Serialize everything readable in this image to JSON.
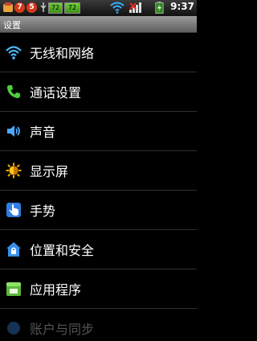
{
  "status_bar": {
    "notif_badge_1": "7",
    "notif_badge_2": "5",
    "battery_level_1": "72",
    "battery_level_2": "72",
    "time": "9:37"
  },
  "title": "设置",
  "menu": [
    {
      "label": "无线和网络",
      "icon": "wifi-icon"
    },
    {
      "label": "通话设置",
      "icon": "phone-icon"
    },
    {
      "label": "声音",
      "icon": "speaker-icon"
    },
    {
      "label": "显示屏",
      "icon": "brightness-icon"
    },
    {
      "label": "手势",
      "icon": "gesture-icon"
    },
    {
      "label": "位置和安全",
      "icon": "lock-icon"
    },
    {
      "label": "应用程序",
      "icon": "app-icon"
    },
    {
      "label": "账户与同步",
      "icon": "sync-icon"
    }
  ],
  "colors": {
    "background": "#000000",
    "title_bar": "#7a7a7a",
    "divider": "#2f2f2f"
  }
}
